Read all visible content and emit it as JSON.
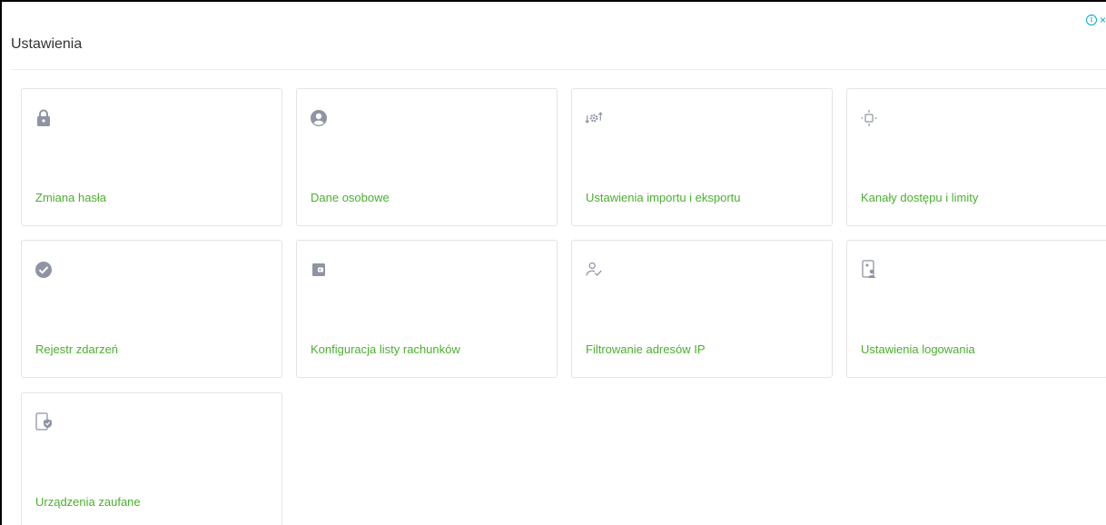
{
  "header": {
    "title": "Ustawienia"
  },
  "ad": {
    "info_glyph": "i",
    "close_glyph": "×"
  },
  "colors": {
    "label": "#4caf2f",
    "icon": "#8e94a3",
    "border": "#e4e4e4",
    "ad": "#00aecd"
  },
  "tiles": [
    {
      "label": "Zmiana hasła",
      "icon": "lock-icon"
    },
    {
      "label": "Dane osobowe",
      "icon": "user-circle-icon"
    },
    {
      "label": "Ustawienia importu i eksportu",
      "icon": "import-export-gear-icon"
    },
    {
      "label": "Kanały dostępu i limity",
      "icon": "access-channels-icon"
    },
    {
      "label": "Rejestr zdarzeń",
      "icon": "check-circle-icon"
    },
    {
      "label": "Konfiguracja listy rachunków",
      "icon": "wallet-icon"
    },
    {
      "label": "Filtrowanie adresów IP",
      "icon": "user-check-icon"
    },
    {
      "label": "Ustawienia logowania",
      "icon": "device-user-icon"
    },
    {
      "label": "Urządzenia zaufane",
      "icon": "device-shield-icon"
    }
  ]
}
